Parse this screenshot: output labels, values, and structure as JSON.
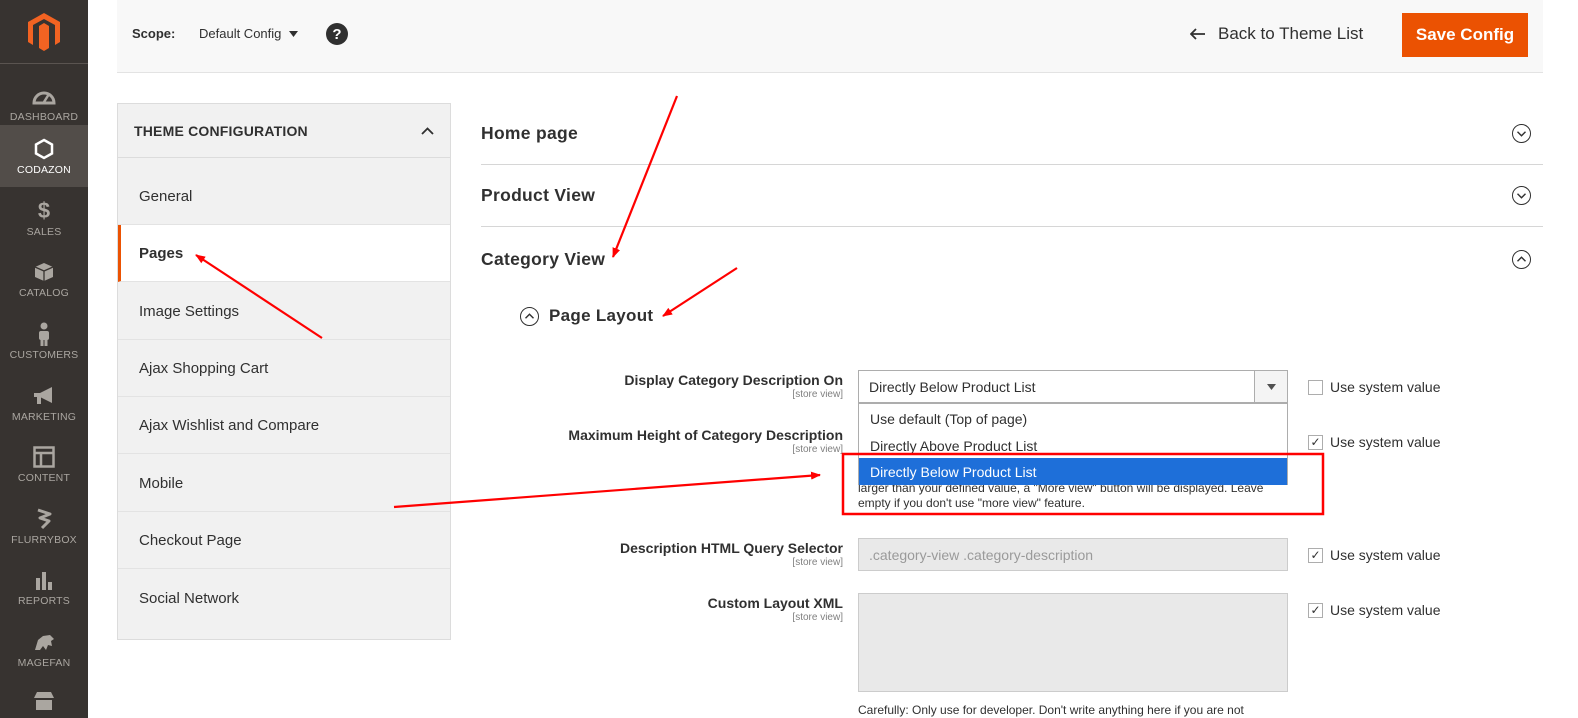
{
  "sidebar": {
    "items": [
      {
        "label": "DASHBOARD",
        "icon": "dashboard-icon",
        "active": false
      },
      {
        "label": "CODAZON",
        "icon": "hexagon-icon",
        "active": true
      },
      {
        "label": "SALES",
        "icon": "dollar-icon",
        "active": false
      },
      {
        "label": "CATALOG",
        "icon": "box-icon",
        "active": false
      },
      {
        "label": "CUSTOMERS",
        "icon": "person-icon",
        "active": false
      },
      {
        "label": "MARKETING",
        "icon": "megaphone-icon",
        "active": false
      },
      {
        "label": "CONTENT",
        "icon": "layout-icon",
        "active": false
      },
      {
        "label": "FLURRYBOX",
        "icon": "flurrybox-icon",
        "active": false
      },
      {
        "label": "REPORTS",
        "icon": "bar-chart-icon",
        "active": false
      },
      {
        "label": "MAGEFAN",
        "icon": "magefan-icon",
        "active": false
      }
    ]
  },
  "header": {
    "scope_label": "Scope:",
    "scope_value": "Default Config",
    "back_label": "Back to Theme List",
    "save_label": "Save Config"
  },
  "config_tabs": {
    "title": "THEME CONFIGURATION",
    "items": [
      {
        "label": "General",
        "active": false
      },
      {
        "label": "Pages",
        "active": true
      },
      {
        "label": "Image Settings",
        "active": false
      },
      {
        "label": "Ajax Shopping Cart",
        "active": false
      },
      {
        "label": "Ajax Wishlist and Compare",
        "active": false
      },
      {
        "label": "Mobile",
        "active": false
      },
      {
        "label": "Checkout Page",
        "active": false
      },
      {
        "label": "Social Network",
        "active": false
      }
    ]
  },
  "sections": [
    {
      "title": "Home page",
      "expanded": false
    },
    {
      "title": "Product View",
      "expanded": false
    },
    {
      "title": "Category View",
      "expanded": true
    }
  ],
  "subsection": {
    "title": "Page Layout"
  },
  "fields": {
    "display_desc": {
      "label": "Display Category Description On",
      "scope": "[store view]",
      "value": "Directly Below Product List",
      "use_system": false,
      "options": [
        "Use default (Top of page)",
        "Directly Above Product List",
        "Directly Below Product List"
      ],
      "selected_index": 2
    },
    "max_height": {
      "label": "Maximum Height of Category Description",
      "scope": "[store view]",
      "use_system": true,
      "hint_line1": "larger than your defined value, a \"More view\" button will be displayed. Leave",
      "hint_line2": "empty if you don't use \"more view\" feature."
    },
    "query_selector": {
      "label": "Description HTML Query Selector",
      "scope": "[store view]",
      "value": ".category-view .category-description",
      "use_system": true
    },
    "custom_xml": {
      "label": "Custom Layout XML",
      "scope": "[store view]",
      "use_system": true,
      "hint": "Carefully: Only use for developer. Don't write anything here if you are not"
    }
  },
  "use_system_label": "Use system value",
  "colors": {
    "accent": "#eb5202",
    "sidebar_bg": "#373330",
    "selected_option": "#1e6fd9",
    "annotation": "#ff0000"
  }
}
